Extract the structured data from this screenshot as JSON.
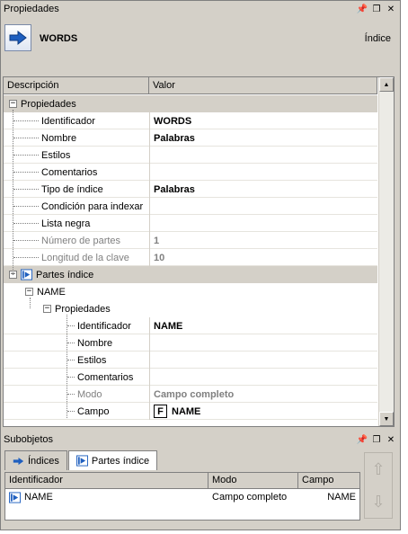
{
  "top_panel": {
    "title": "Propiedades"
  },
  "header": {
    "name": "WORDS",
    "right_label": "Índice"
  },
  "grid": {
    "col_description": "Descripción",
    "col_value": "Valor",
    "section1": "Propiedades",
    "props1": [
      {
        "label": "Identificador",
        "value": "WORDS",
        "disabled": false
      },
      {
        "label": "Nombre",
        "value": "Palabras",
        "disabled": false
      },
      {
        "label": "Estilos",
        "value": "",
        "disabled": false
      },
      {
        "label": "Comentarios",
        "value": "",
        "disabled": false
      },
      {
        "label": "Tipo de índice",
        "value": "Palabras",
        "disabled": false
      },
      {
        "label": "Condición para indexar",
        "value": "",
        "disabled": false
      },
      {
        "label": "Lista negra",
        "value": "",
        "disabled": false
      },
      {
        "label": "Número de partes",
        "value": "1",
        "disabled": true
      },
      {
        "label": "Longitud de la clave",
        "value": "10",
        "disabled": true
      }
    ],
    "section2": "Partes índice",
    "part_name": "NAME",
    "part_section": "Propiedades",
    "props2": [
      {
        "label": "Identificador",
        "value": "NAME",
        "disabled": false
      },
      {
        "label": "Nombre",
        "value": "",
        "disabled": false
      },
      {
        "label": "Estilos",
        "value": "",
        "disabled": false
      },
      {
        "label": "Comentarios",
        "value": "",
        "disabled": false
      },
      {
        "label": "Modo",
        "value": "Campo completo",
        "disabled": true
      },
      {
        "label": "Campo",
        "value": "NAME",
        "disabled": false
      }
    ],
    "field_icon_letter": "F"
  },
  "bottom_panel": {
    "title": "Subobjetos",
    "tabs": [
      "Índices",
      "Partes índice"
    ],
    "columns": [
      "Identificador",
      "Modo",
      "Campo"
    ],
    "rows": [
      {
        "identificador": "NAME",
        "modo": "Campo completo",
        "campo": "NAME"
      }
    ]
  },
  "colors": {
    "icon_blue": "#1f5fbf",
    "panel_gray": "#d4d0c8",
    "disabled_text": "#808080"
  }
}
